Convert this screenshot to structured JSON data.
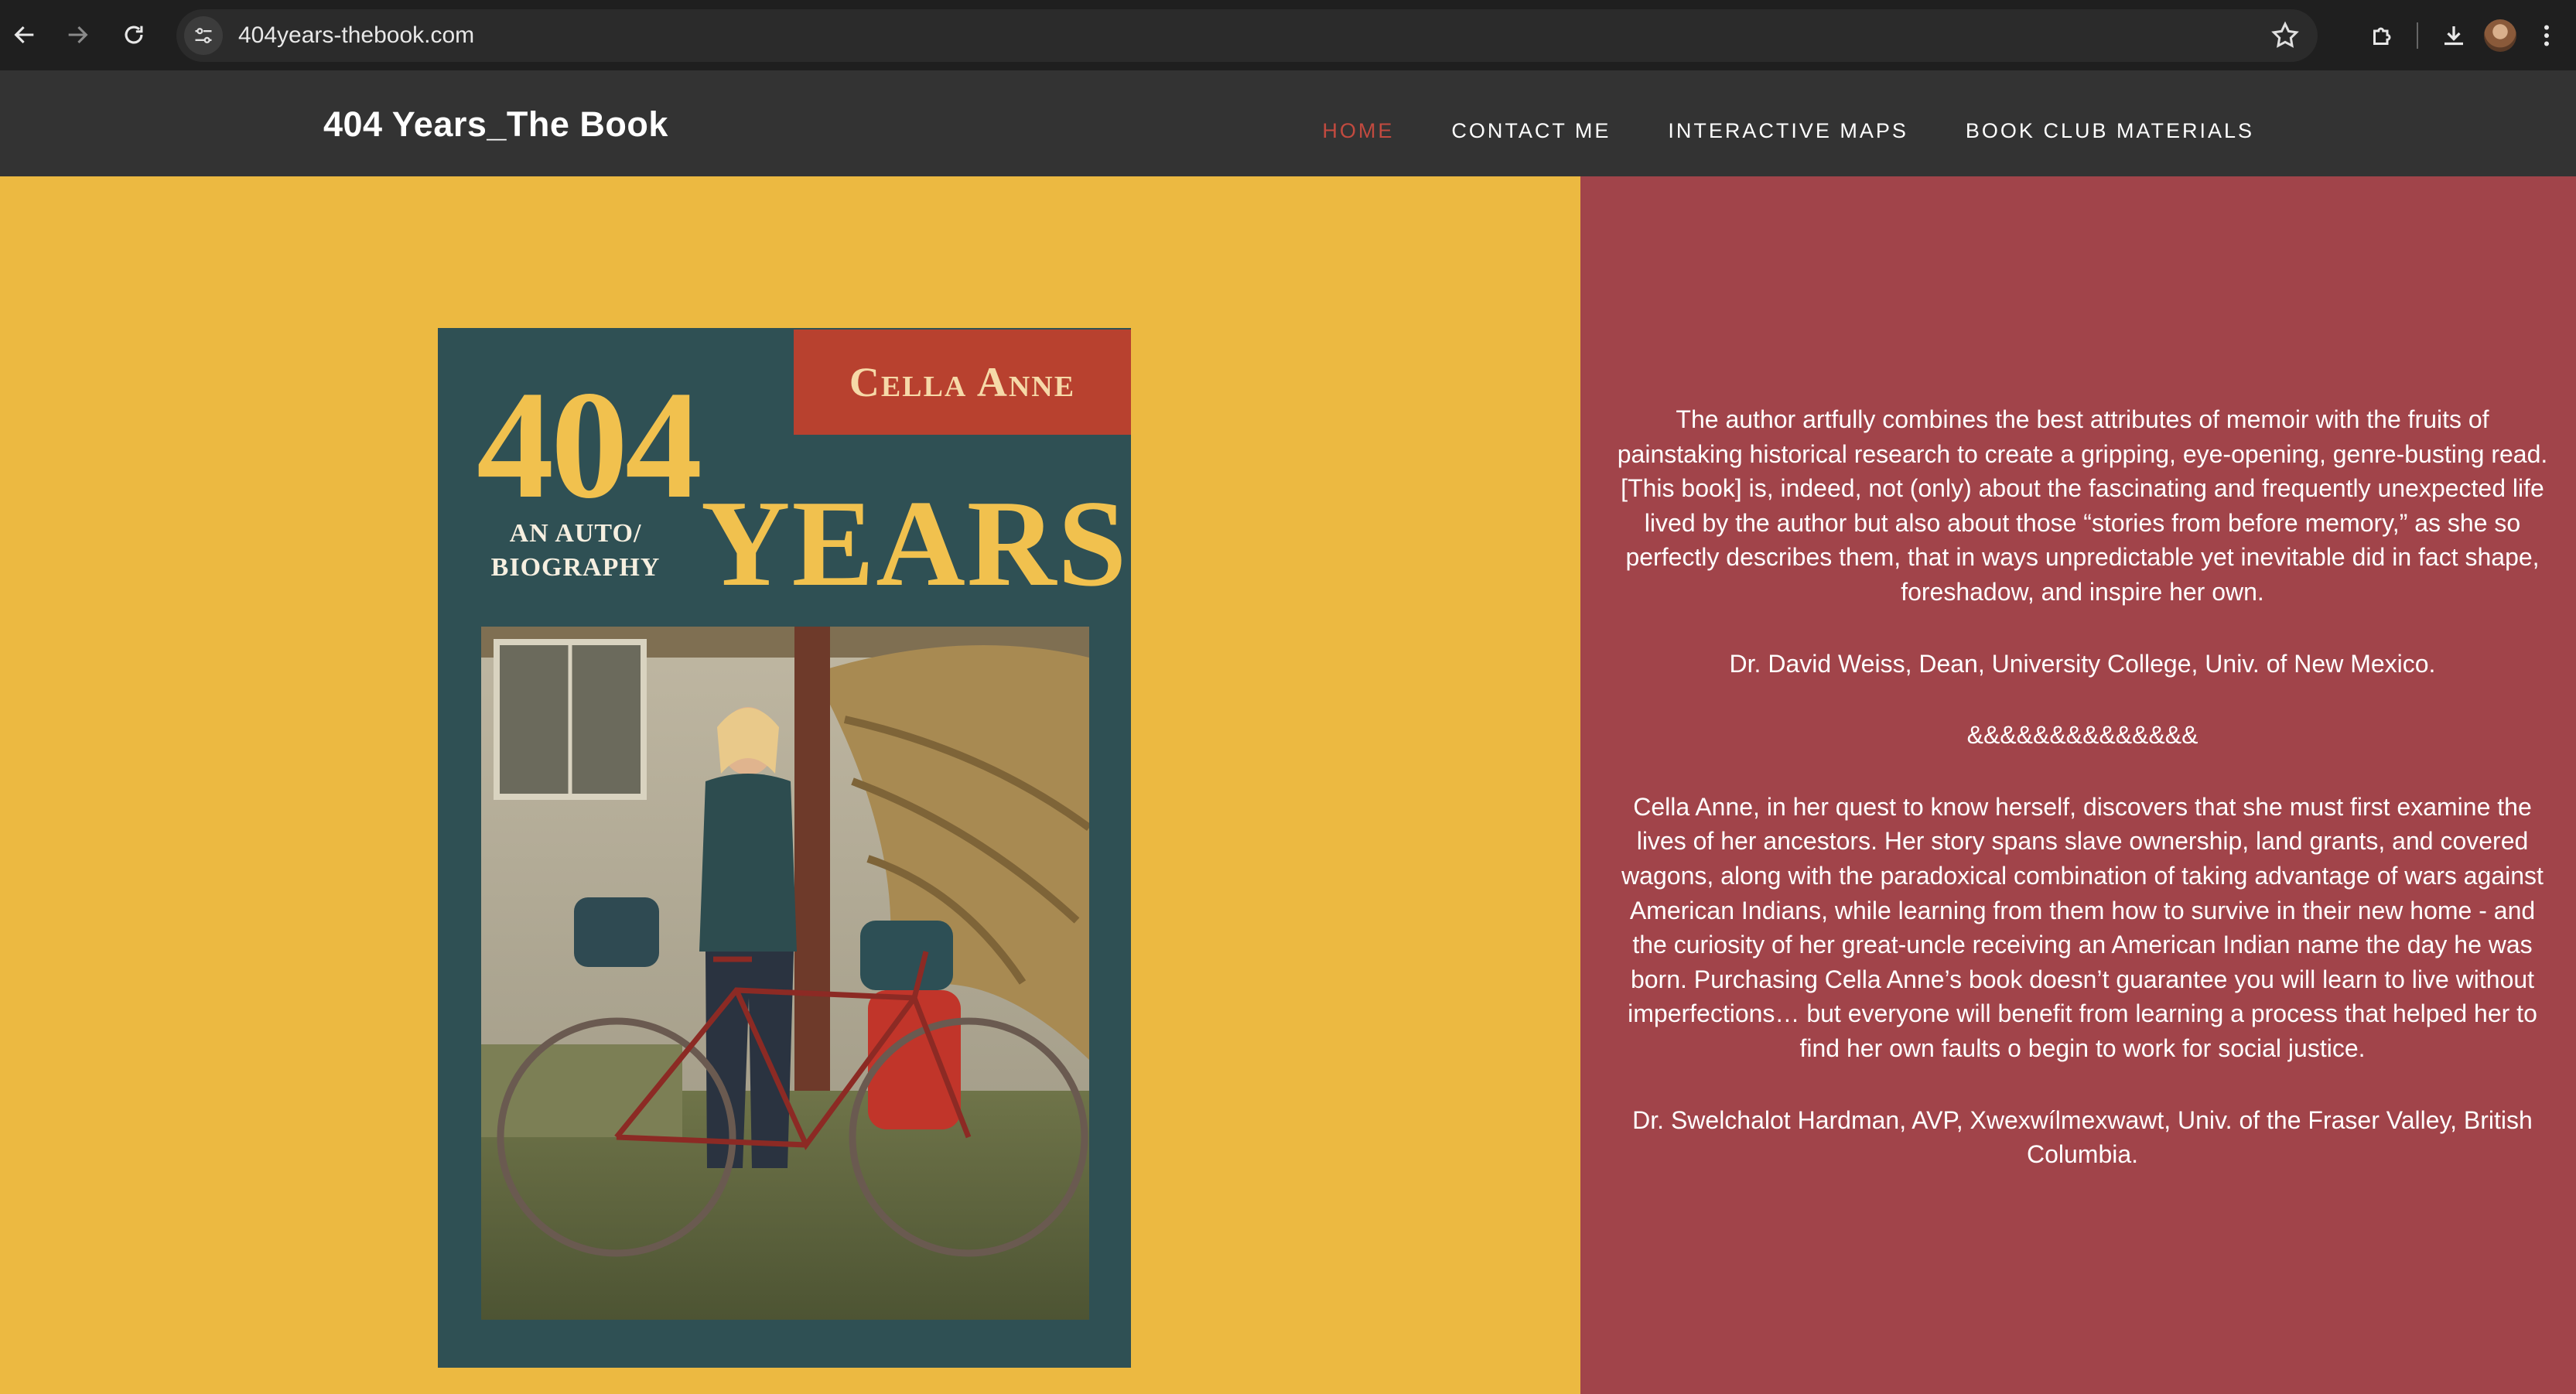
{
  "browser": {
    "url": "404years-thebook.com"
  },
  "site": {
    "title": "404 Years_The Book",
    "nav": [
      {
        "label": "HOME",
        "active": true
      },
      {
        "label": "CONTACT ME",
        "active": false
      },
      {
        "label": "INTERACTIVE MAPS",
        "active": false
      },
      {
        "label": "BOOK CLUB MATERIALS",
        "active": false
      }
    ]
  },
  "book": {
    "author": "Cella Anne",
    "title_number": "404",
    "title_word": "YEARS",
    "subtitle_line1": "AN AUTO/",
    "subtitle_line2": "BIOGRAPHY"
  },
  "testimonials": {
    "quote1": "The author artfully combines the best attributes of memoir with the fruits of painstaking historical research to create a gripping, eye-opening, genre-busting read. [This book] is, indeed, not (only) about the fascinating and frequently unexpected life lived by the author but also about those “stories from before memory,” as she so perfectly describes them, that in ways unpredictable yet inevitable did in fact shape, foreshadow, and inspire her own.",
    "attribution1": "Dr. David Weiss, Dean, University College, Univ. of New Mexico.",
    "divider": "&&&&&&&&&&&&&&",
    "quote2": "Cella Anne, in her quest to know herself, discovers that she must first examine the lives of her ancestors. Her story spans slave ownership, land grants, and covered wagons, along with the paradoxical combination of taking advantage of wars against American Indians, while learning from them how to survive in their new home - and the curiosity of her great-uncle receiving an American Indian name the day he was born. Purchasing Cella Anne’s book doesn’t guarantee you will learn to live without imperfections… but everyone will benefit from learning a process that helped her to find her own faults o begin to work for social justice.",
    "attribution2": "Dr. Swelchalot Hardman, AVP, Xwexwílmexwawt, Univ. of the Fraser Valley, British Columbia."
  },
  "colors": {
    "left_panel": "#ecb941",
    "right_panel": "#a1444a",
    "header": "#333333",
    "nav_active": "#c24a3f",
    "cover": "#2f5054"
  }
}
